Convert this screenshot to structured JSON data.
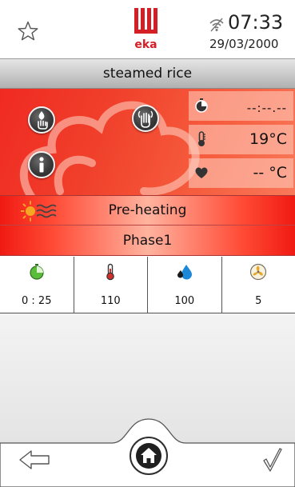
{
  "header": {
    "time": "07:33",
    "date": "29/03/2000",
    "brand": "eka",
    "favorite_icon": "star-outline-icon",
    "wifi_icon": "wifi-icon"
  },
  "recipe": {
    "title": "steamed rice"
  },
  "cooking": {
    "timer": "--:--.--",
    "chamber_temperature": "19°C",
    "core_temperature": "-- °C"
  },
  "status": {
    "label": "Pre-heating",
    "icon": "sun-heat-icon"
  },
  "phase": {
    "label": "Phase1"
  },
  "params": [
    {
      "name": "time",
      "icon": "timer-icon",
      "value": "0 : 25"
    },
    {
      "name": "temperature",
      "icon": "thermometer-icon",
      "value": "110"
    },
    {
      "name": "humidity",
      "icon": "water-drop-icon",
      "value": "100"
    },
    {
      "name": "fan",
      "icon": "fan-icon",
      "value": "5"
    }
  ],
  "footer": {
    "back_icon": "arrow-left-icon",
    "home_icon": "home-icon",
    "confirm_icon": "checkmark-icon"
  },
  "colors": {
    "accent_red": "#f02a22",
    "panel_light": "#ffc8b9",
    "title_bar": "#c9c9c9",
    "temp_icon_red": "#d0302a",
    "drop_blue": "#1e88d8",
    "timer_green": "#3c9a2e"
  }
}
